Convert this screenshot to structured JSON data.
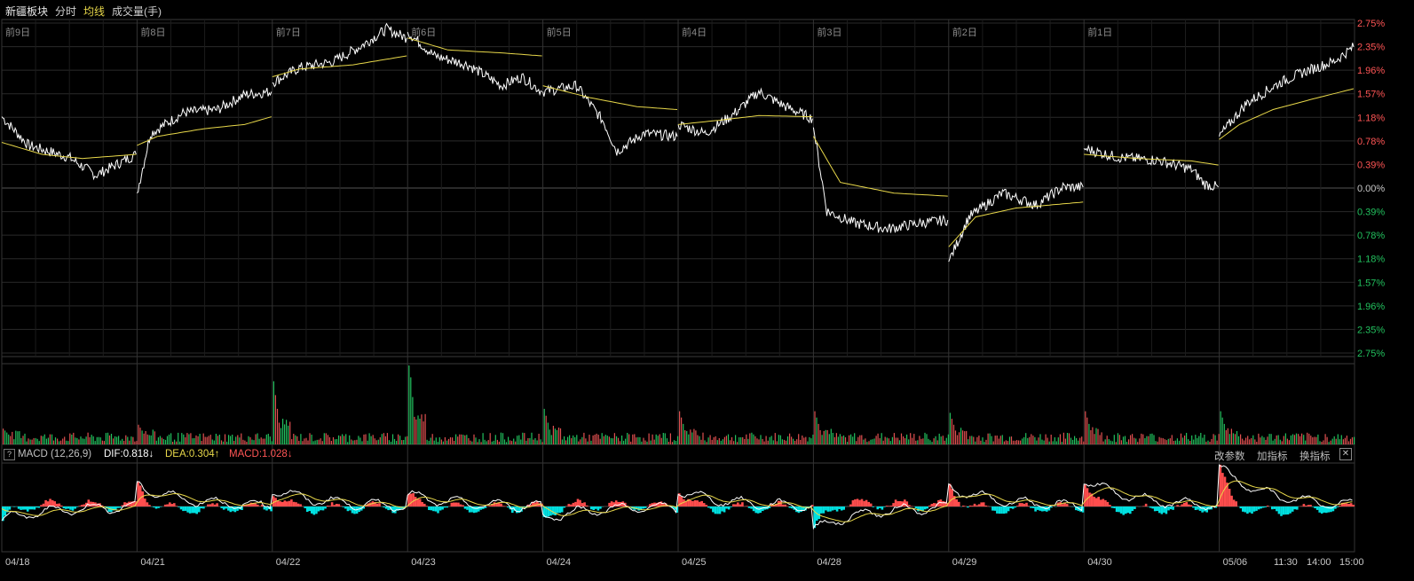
{
  "header": {
    "name": "新疆板块",
    "mode": "分时",
    "ma_label": "均线",
    "volume_label": "成交量(手)"
  },
  "macd": {
    "help": "?",
    "title": "MACD (12,26,9)",
    "dif": "DIF:0.818↓",
    "dea": "DEA:0.304↑",
    "macd_value": "MACD:1.028↓",
    "btn_params": "改参数",
    "btn_add": "加指标",
    "btn_switch": "换指标",
    "close": "✕"
  },
  "colors": {
    "up": "#ff4d4d",
    "down": "#00e0e0",
    "vol_up": "#e05050",
    "vol_down": "#22c15e",
    "price_line": "#ffffff",
    "avg_line": "#e8d84a",
    "grid": "#2a2a2a"
  },
  "chart_data": {
    "type": "line",
    "day_labels": [
      "前9日",
      "前8日",
      "前7日",
      "前6日",
      "前5日",
      "前4日",
      "前3日",
      "前2日",
      "前1日"
    ],
    "x_tick_labels": [
      "04/18",
      "04/21",
      "04/22",
      "04/23",
      "04/24",
      "04/25",
      "04/28",
      "04/29",
      "04/30",
      "05/06",
      "11:30",
      "14:00",
      "15:00"
    ],
    "y_tick_labels": [
      "2.75%",
      "2.35%",
      "1.96%",
      "1.57%",
      "1.18%",
      "0.78%",
      "0.39%",
      "0.00%",
      "0.39%",
      "0.78%",
      "1.18%",
      "1.57%",
      "1.96%",
      "2.35%",
      "2.75%"
    ],
    "ylim": [
      -2.75,
      2.75
    ],
    "price_segments": [
      [
        [
          0,
          1.18
        ],
        [
          0.2,
          0.7
        ],
        [
          0.5,
          0.5
        ],
        [
          0.7,
          0.2
        ],
        [
          1,
          0.55
        ]
      ],
      [
        [
          0,
          -0.1
        ],
        [
          0.1,
          0.9
        ],
        [
          0.35,
          1.25
        ],
        [
          0.6,
          1.3
        ],
        [
          0.8,
          1.55
        ],
        [
          1,
          1.6
        ]
      ],
      [
        [
          0,
          1.75
        ],
        [
          0.2,
          2.0
        ],
        [
          0.45,
          2.1
        ],
        [
          0.65,
          2.35
        ],
        [
          0.85,
          2.65
        ],
        [
          1,
          2.5
        ]
      ],
      [
        [
          0,
          2.6
        ],
        [
          0.2,
          2.2
        ],
        [
          0.45,
          2.05
        ],
        [
          0.7,
          1.7
        ],
        [
          0.85,
          1.85
        ],
        [
          1,
          1.6
        ]
      ],
      [
        [
          0,
          1.6
        ],
        [
          0.25,
          1.7
        ],
        [
          0.45,
          1.1
        ],
        [
          0.55,
          0.6
        ],
        [
          0.75,
          0.9
        ],
        [
          1,
          0.85
        ]
      ],
      [
        [
          0,
          1.05
        ],
        [
          0.2,
          0.9
        ],
        [
          0.4,
          1.2
        ],
        [
          0.6,
          1.6
        ],
        [
          0.8,
          1.35
        ],
        [
          1,
          1.15
        ]
      ],
      [
        [
          0,
          1.0
        ],
        [
          0.1,
          -0.4
        ],
        [
          0.3,
          -0.6
        ],
        [
          0.55,
          -0.7
        ],
        [
          0.8,
          -0.6
        ],
        [
          1,
          -0.55
        ]
      ],
      [
        [
          0,
          -1.25
        ],
        [
          0.15,
          -0.5
        ],
        [
          0.4,
          -0.1
        ],
        [
          0.65,
          -0.3
        ],
        [
          0.85,
          0.0
        ],
        [
          1,
          0.0
        ]
      ],
      [
        [
          0,
          0.65
        ],
        [
          0.25,
          0.5
        ],
        [
          0.55,
          0.45
        ],
        [
          0.8,
          0.3
        ],
        [
          0.9,
          0.05
        ],
        [
          1,
          0.0
        ]
      ],
      [
        [
          0,
          0.85
        ],
        [
          0.2,
          1.4
        ],
        [
          0.45,
          1.75
        ],
        [
          0.65,
          1.95
        ],
        [
          0.85,
          2.1
        ],
        [
          1,
          2.35
        ]
      ]
    ],
    "avg_segments": [
      [
        [
          0,
          0.75
        ],
        [
          0.3,
          0.55
        ],
        [
          0.6,
          0.48
        ],
        [
          1,
          0.55
        ]
      ],
      [
        [
          0,
          0.7
        ],
        [
          0.15,
          0.85
        ],
        [
          0.5,
          0.98
        ],
        [
          0.8,
          1.05
        ],
        [
          1,
          1.18
        ]
      ],
      [
        [
          0,
          1.85
        ],
        [
          0.2,
          1.98
        ],
        [
          0.6,
          2.05
        ],
        [
          1,
          2.2
        ]
      ],
      [
        [
          0,
          2.5
        ],
        [
          0.3,
          2.3
        ],
        [
          0.7,
          2.25
        ],
        [
          1,
          2.2
        ]
      ],
      [
        [
          0,
          1.7
        ],
        [
          0.35,
          1.5
        ],
        [
          0.7,
          1.35
        ],
        [
          1,
          1.3
        ]
      ],
      [
        [
          0,
          1.05
        ],
        [
          0.3,
          1.12
        ],
        [
          0.6,
          1.2
        ],
        [
          1,
          1.18
        ]
      ],
      [
        [
          0,
          0.85
        ],
        [
          0.2,
          0.08
        ],
        [
          0.6,
          -0.1
        ],
        [
          1,
          -0.15
        ]
      ],
      [
        [
          0,
          -1.0
        ],
        [
          0.2,
          -0.5
        ],
        [
          0.5,
          -0.35
        ],
        [
          1,
          -0.25
        ]
      ],
      [
        [
          0,
          0.55
        ],
        [
          0.4,
          0.48
        ],
        [
          0.8,
          0.44
        ],
        [
          1,
          0.37
        ]
      ],
      [
        [
          0,
          0.8
        ],
        [
          0.15,
          1.05
        ],
        [
          0.4,
          1.3
        ],
        [
          0.7,
          1.48
        ],
        [
          1,
          1.65
        ]
      ]
    ],
    "volume_spikes": [
      0.1,
      0.15,
      0.7,
      1.0,
      0.35,
      0.32,
      0.32,
      0.3,
      0.32,
      0.32
    ],
    "macd_dif_hints": [
      -0.7,
      1.1,
      0.9,
      0.6,
      -0.6,
      0.8,
      -1.2,
      1.0,
      1.4,
      2.0
    ]
  }
}
